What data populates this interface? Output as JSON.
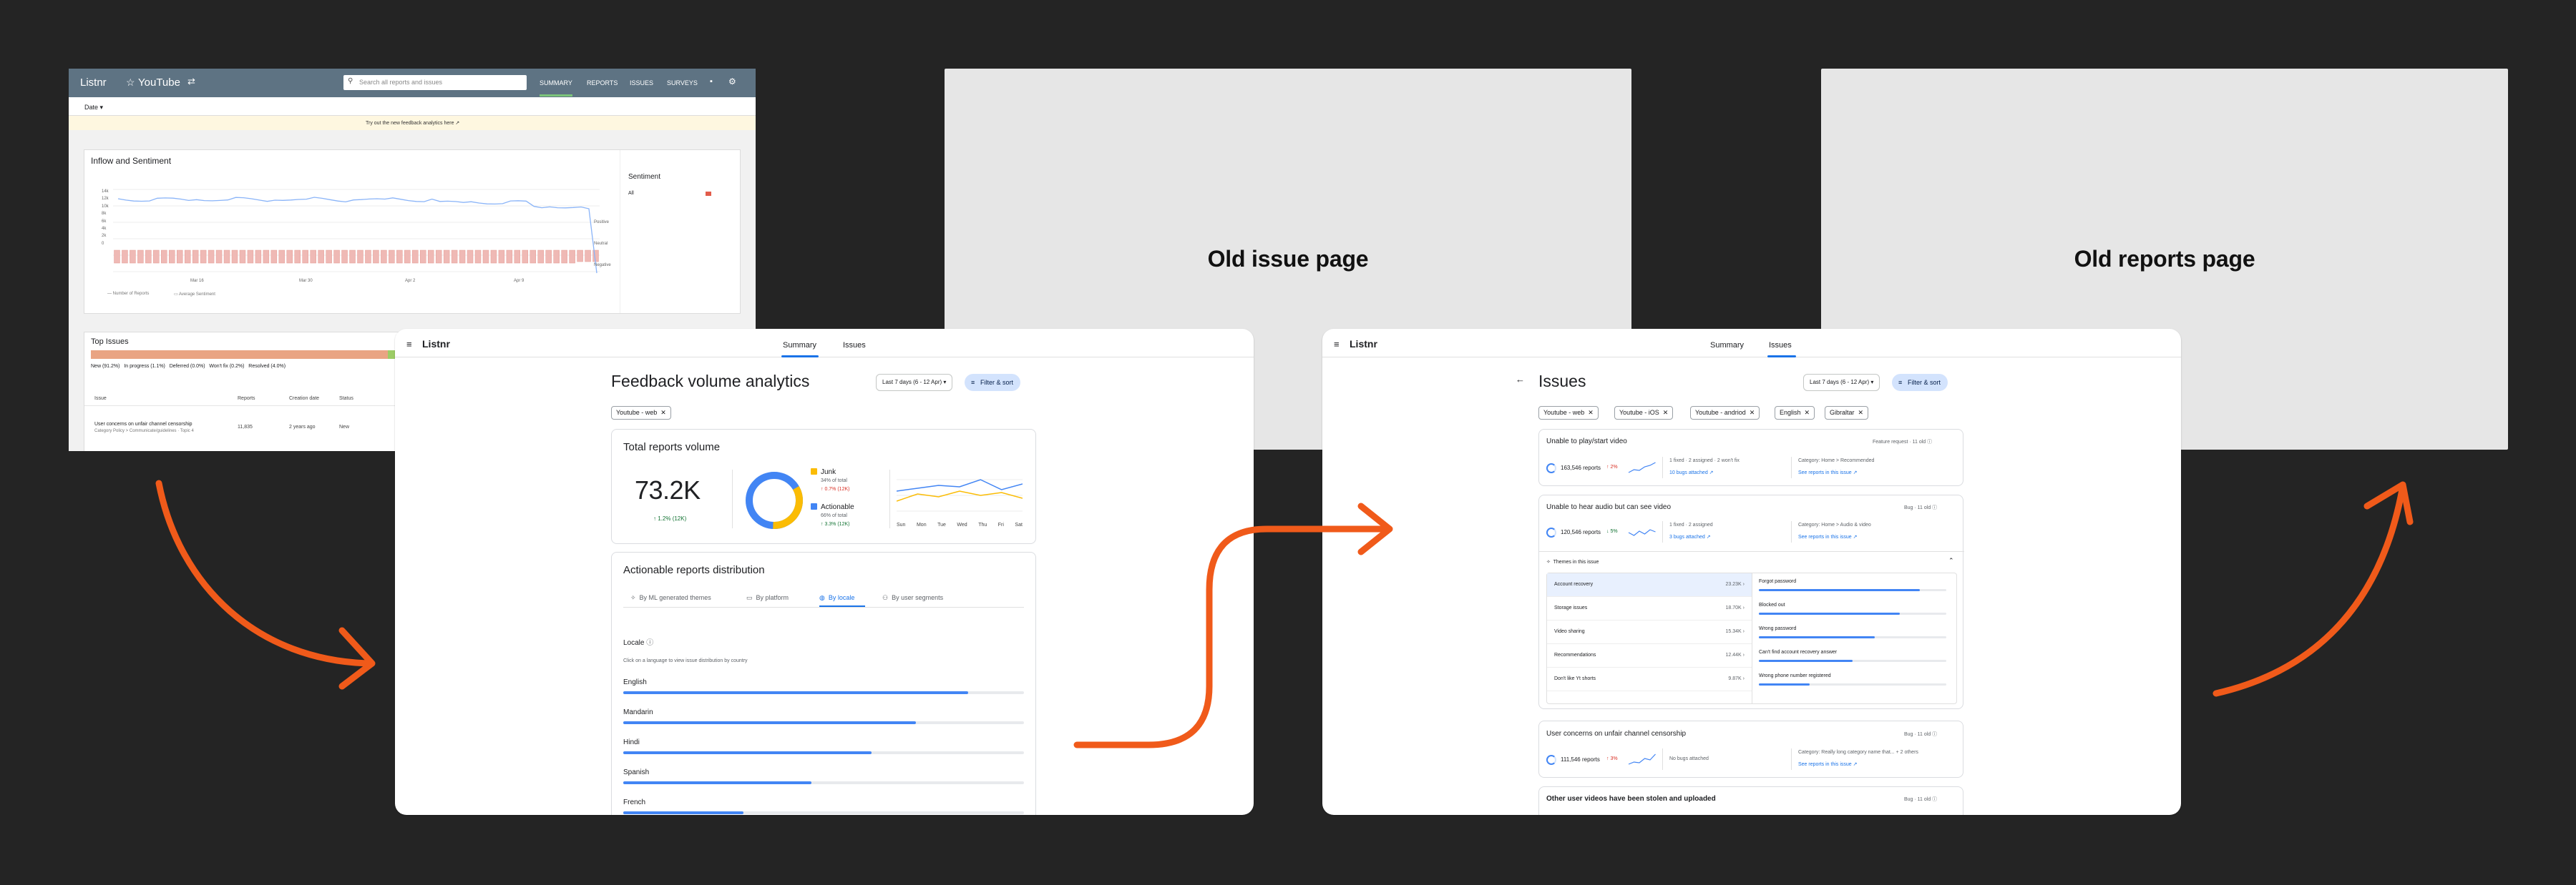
{
  "panels": {
    "old_issue": "Old issue page",
    "old_reports": "Old reports page"
  },
  "old_summary": {
    "brand": "Listnr",
    "app": "YouTube",
    "search_placeholder": "Search all reports and issues",
    "nav": [
      "SUMMARY",
      "REPORTS",
      "ISSUES",
      "SURVEYS"
    ],
    "date_filter": "Date ▾",
    "banner": "Try out the new feedback analytics here ↗",
    "inflow": {
      "title": "Inflow and Sentiment",
      "y_ticks": [
        "14k",
        "12k",
        "10k",
        "8k",
        "6k",
        "4k",
        "2k",
        "0"
      ],
      "x_ticks": [
        "Mar 16",
        "Mar 30",
        "Apr 2",
        "Apr 9"
      ],
      "right_ticks": [
        "Positive",
        "Neutral",
        "Negative"
      ],
      "legend": [
        "Number of Reports",
        "Average Sentiment"
      ]
    },
    "sentiment": {
      "title": "Sentiment",
      "label": "All"
    },
    "top_issues": {
      "title": "Top Issues",
      "statuses": [
        "New (91.2%)",
        "In progress (1.1%)",
        "Deferred (0.0%)",
        "Won't fix (0.2%)",
        "Resolved (4.0%)"
      ],
      "headers": [
        "Issue",
        "Reports",
        "Creation date",
        "Status"
      ],
      "row": {
        "title": "User concerns on unfair channel censorship",
        "sub": "Category Policy > Communicate/guidelines · Topic 4",
        "reports": "11,835",
        "date": "2 years ago",
        "status": "New"
      }
    }
  },
  "feedback": {
    "brand": "Listnr",
    "tabs": [
      "Summary",
      "Issues"
    ],
    "title": "Feedback volume analytics",
    "date_range": "Last 7 days (6 - 12 Apr)",
    "filter": "Filter & sort",
    "chip": "Youtube - web",
    "total": {
      "title": "Total reports volume",
      "value": "73.2K",
      "delta": "1.2% (12K)",
      "junk": {
        "label": "Junk",
        "pct": "34% of total",
        "delta": "0.7% (12K)"
      },
      "actionable": {
        "label": "Actionable",
        "pct": "66% of total",
        "delta": "3.3% (12K)"
      },
      "days": [
        "Sun",
        "Mon",
        "Tue",
        "Wed",
        "Thu",
        "Fri",
        "Sat"
      ]
    },
    "dist": {
      "title": "Actionable reports distribution",
      "tabs": [
        "By ML generated themes",
        "By platform",
        "By locale",
        "By user segments"
      ],
      "locale_title": "Locale",
      "hint": "Click on a language to view issue distribution by country",
      "locales": [
        {
          "name": "English",
          "value": 0.86
        },
        {
          "name": "Mandarin",
          "value": 0.73
        },
        {
          "name": "Hindi",
          "value": 0.62
        },
        {
          "name": "Spanish",
          "value": 0.47
        },
        {
          "name": "French",
          "value": 0.3
        }
      ]
    }
  },
  "issues": {
    "brand": "Listnr",
    "tabs": [
      "Summary",
      "Issues"
    ],
    "title": "Issues",
    "date_range": "Last 7 days (6 - 12 Apr)",
    "filter": "Filter & sort",
    "chips": [
      "Youtube - web",
      "Youtube - iOS",
      "Youtube - andriod",
      "English",
      "Gibraltar"
    ],
    "cards": [
      {
        "title": "Unable to play/start video",
        "type": "Feature request · 11 old",
        "reports": "163,546 reports",
        "delta": "2%",
        "delta_dir": "up",
        "meta": "1 fixed · 2 assigned · 2 won't fix",
        "bugs": "10 bugs attached",
        "category": "Category: Home > Recommended",
        "see": "See reports in this issue ↗"
      },
      {
        "title": "Unable to hear audio but can see video",
        "type": "Bug · 11 old",
        "reports": "120,546 reports",
        "delta": "5%",
        "delta_dir": "down",
        "meta": "1 fixed · 2 assigned",
        "bugs": "3 bugs attached",
        "category": "Category: Home > Audio & video",
        "see": "See reports in this issue ↗"
      },
      {
        "title": "User concerns on unfair channel censorship",
        "type": "Bug · 11 old",
        "reports": "111,546 reports",
        "delta": "3%",
        "delta_dir": "up",
        "meta": "No bugs attached",
        "bugs": "",
        "category": "Category: Really long category name that... + 2 others",
        "see": "See reports in this issue ↗"
      },
      {
        "title": "Other user videos have been stolen and uploaded",
        "type": "Bug · 11 old"
      }
    ],
    "themes": {
      "title": "Themes in this issue",
      "rows": [
        {
          "name": "Account recovery",
          "count": "23.23K"
        },
        {
          "name": "Storage issues",
          "count": "18.70K"
        },
        {
          "name": "Video sharing",
          "count": "15.34K"
        },
        {
          "name": "Recommendations",
          "count": "12.44K"
        },
        {
          "name": "Don't like Yt shorts",
          "count": "9.87K"
        }
      ],
      "subs": [
        {
          "name": "Forgot password",
          "value": 0.86
        },
        {
          "name": "Blocked out",
          "value": 0.75
        },
        {
          "name": "Wrong password",
          "value": 0.62
        },
        {
          "name": "Can't find account recovery answer",
          "value": 0.5
        },
        {
          "name": "Wrong phone number registered",
          "value": 0.27
        }
      ]
    }
  },
  "colors": {
    "accent": "#1a73e8",
    "arrow": "#f05a1a",
    "junk": "#fbbc04",
    "actionable": "#4285f4"
  }
}
